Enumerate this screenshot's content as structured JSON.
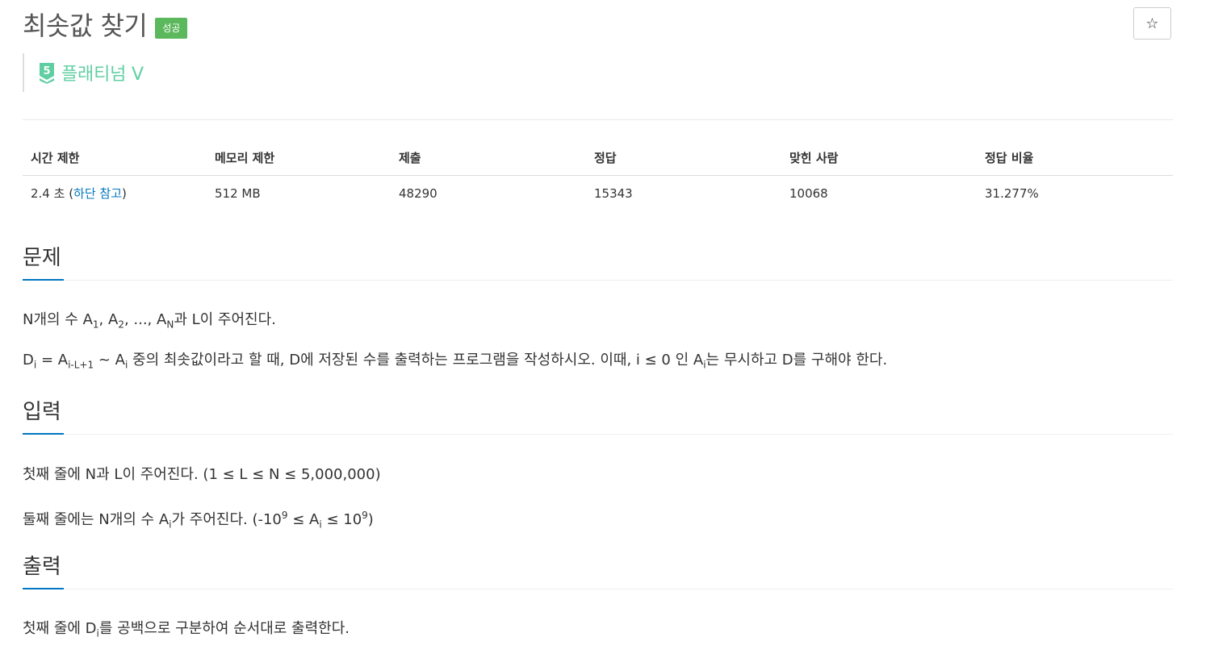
{
  "header": {
    "title": "최솟값 찾기",
    "status_badge": "성공",
    "star_button": "☆",
    "tier": {
      "level": "5",
      "label": "플래티넘 V"
    }
  },
  "info_table": {
    "headers": [
      "시간 제한",
      "메모리 제한",
      "제출",
      "정답",
      "맞힌 사람",
      "정답 비율"
    ],
    "values": {
      "time_value": "2.4 초 (",
      "time_link": "하단 참고",
      "time_close": ")",
      "memory": "512 MB",
      "submissions": "48290",
      "accepted": "15343",
      "solvers": "10068",
      "ratio": "31.277%"
    }
  },
  "sections": {
    "problem": {
      "title": "문제",
      "line1": {
        "a": "N개의 수 A",
        "s1": "1",
        "b": ", A",
        "s2": "2",
        "c": ", ..., A",
        "s3": "N",
        "d": "과 L이 주어진다."
      },
      "line2": {
        "a": "D",
        "s1": "i",
        "b": " = A",
        "s2": "i-L+1",
        "c": " ~ A",
        "s3": "i",
        "d": " 중의 최솟값이라고 할 때, D에 저장된 수를 출력하는 프로그램을 작성하시오. 이때, i ≤ 0 인 A",
        "s4": "i",
        "e": "는 무시하고 D를 구해야 한다."
      }
    },
    "input": {
      "title": "입력",
      "line1": "첫째 줄에 N과 L이 주어진다. (1 ≤ L ≤ N ≤ 5,000,000)",
      "line2": {
        "a": "둘째 줄에는 N개의 수 A",
        "s1": "i",
        "b": "가 주어진다. (-10",
        "p1": "9",
        "c": " ≤ A",
        "s2": "i",
        "d": " ≤ 10",
        "p2": "9",
        "e": ")"
      }
    },
    "output": {
      "title": "출력",
      "line1": {
        "a": "첫째 줄에 D",
        "s1": "i",
        "b": "를 공백으로 구분하여 순서대로 출력한다."
      }
    }
  },
  "colors": {
    "accent": "#0076c0",
    "success_badge": "#5cb85c",
    "tier_platinum": "#5fcfa2"
  }
}
